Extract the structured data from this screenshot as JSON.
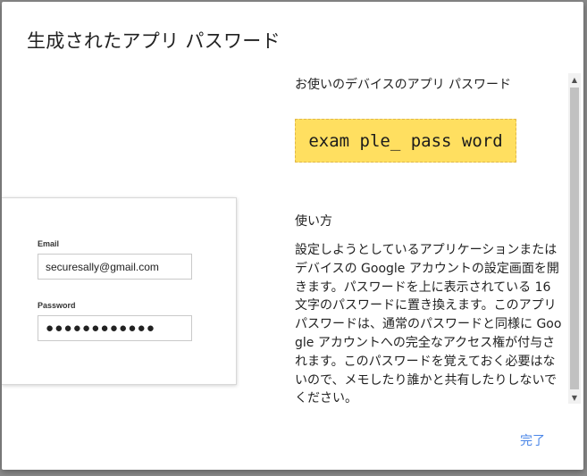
{
  "dialog": {
    "title": "生成されたアプリ パスワード"
  },
  "login_illustration": {
    "email_label": "Email",
    "email_value": "securesally@gmail.com",
    "password_label": "Password",
    "password_value": "●●●●●●●●●●●●"
  },
  "content": {
    "device_label": "お使いのデバイスのアプリ パスワード",
    "app_password": "exam ple_ pass word",
    "howto_heading": "使い方",
    "howto_text": "設定しようとしているアプリケーションまたはデバイスの Google アカウントの設定画面を開きます。パスワードを上に表示されている 16 文字のパスワードに置き換えます。このアプリ パスワードは、通常のパスワードと同様に Google アカウントへの完全なアクセス権が付与されます。このパスワードを覚えておく必要はないので、メモしたり誰かと共有したりしないでください。"
  },
  "footer": {
    "done_label": "完了"
  },
  "scrollbar": {
    "up_icon": "▲",
    "down_icon": "▼"
  },
  "colors": {
    "password_highlight": "#ffdf60",
    "accent": "#4a86e8"
  }
}
